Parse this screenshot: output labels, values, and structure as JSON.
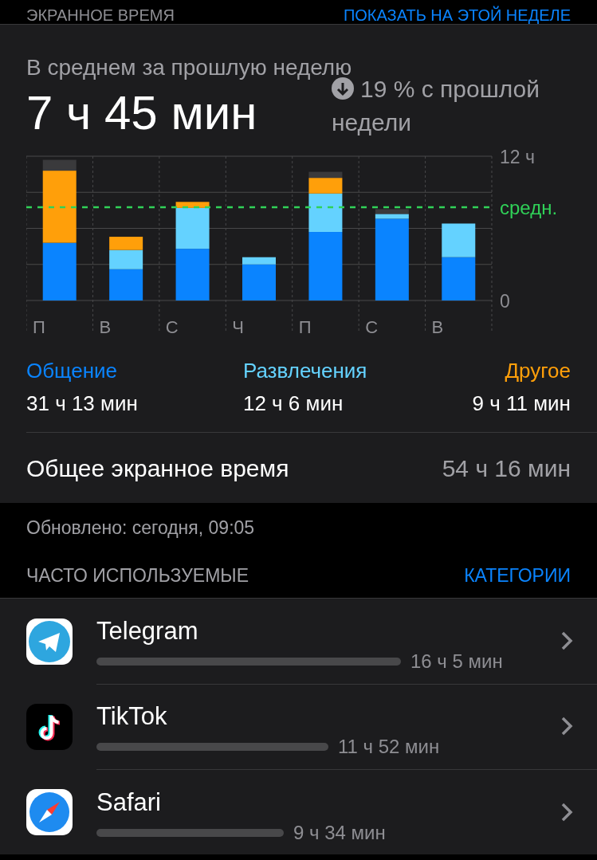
{
  "header": {
    "title": "ЭКРАННОЕ ВРЕМЯ",
    "action": "ПОКАЗАТЬ НА ЭТОЙ НЕДЕЛЕ"
  },
  "summary": {
    "caption": "В среднем за прошлую неделю",
    "average": "7 ч 45 мин",
    "change": "19 % с прошлой недели"
  },
  "chart_data": {
    "type": "bar",
    "stacked": true,
    "categories": [
      "П",
      "В",
      "С",
      "Ч",
      "П",
      "С",
      "В"
    ],
    "series": [
      {
        "name": "Общение",
        "color": "#0a84ff",
        "values": [
          4.8,
          2.6,
          4.3,
          3.0,
          5.7,
          6.8,
          3.6
        ]
      },
      {
        "name": "Развлечения",
        "color": "#64d2ff",
        "values": [
          0,
          1.6,
          3.4,
          0.6,
          3.2,
          0.4,
          2.8
        ]
      },
      {
        "name": "Другое",
        "color": "#ff9f0a",
        "values": [
          6.0,
          1.1,
          0.5,
          0,
          1.3,
          0,
          0
        ]
      },
      {
        "color": "#3a3a3c",
        "values": [
          0.9,
          0,
          0,
          0,
          0.5,
          0.4,
          0
        ]
      }
    ],
    "ylim": [
      0,
      12
    ],
    "yticks": [
      {
        "value": 0,
        "label": "0"
      },
      {
        "value": 12,
        "label": "12 ч"
      }
    ],
    "ref_lines": [
      {
        "axis": "y",
        "value": 7.75,
        "label": "средн."
      }
    ]
  },
  "categories": [
    {
      "time": "31 ч 13 мин"
    },
    {
      "time": "12 ч 6 мин"
    },
    {
      "time": "9 ч 11 мин"
    }
  ],
  "total": {
    "label": "Общее экранное время",
    "value": "54 ч 16 мин"
  },
  "updated": "Обновлено: сегодня, 09:05",
  "most_used": {
    "title": "ЧАСТО ИСПОЛЬЗУЕМЫЕ",
    "action": "КАТЕГОРИИ",
    "apps": [
      {
        "name": "Telegram",
        "time": "16 ч 5 мин",
        "kind": "plane"
      },
      {
        "name": "TikTok",
        "time": "11 ч 52 мин",
        "kind": "note"
      },
      {
        "name": "Safari",
        "time": "9 ч 34 мин",
        "kind": "compass"
      }
    ]
  }
}
